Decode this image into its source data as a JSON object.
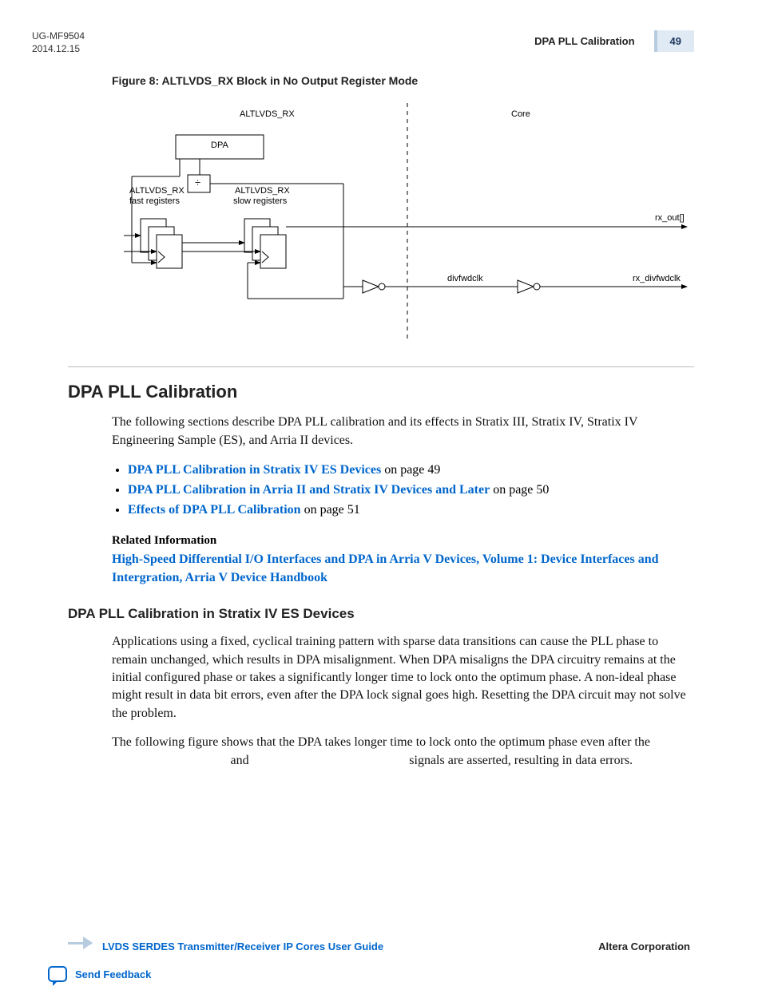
{
  "header": {
    "doc_id": "UG-MF9504",
    "date": "2014.12.15",
    "section_title": "DPA PLL Calibration",
    "page_num": "49"
  },
  "figure": {
    "caption": "Figure 8: ALTLVDS_RX Block in No Output Register Mode",
    "labels": {
      "altlvds_rx_top": "ALTLVDS_RX",
      "core": "Core",
      "dpa": "DPA",
      "divide": "÷",
      "fast_line1": "ALTLVDS_RX",
      "fast_line2": "fast registers",
      "slow_line1": "ALTLVDS_RX",
      "slow_line2": "slow registers",
      "rx_out": "rx_out[]",
      "divfwdclk": "divfwdclk",
      "rx_divfwdclk": "rx_divfwdclk"
    }
  },
  "h2": "DPA PLL Calibration",
  "intro": "The following sections describe DPA PLL calibration and its effects in Stratix III, Stratix IV, Stratix IV Engineering Sample (ES), and Arria II  devices.",
  "bullets": [
    {
      "link": "DPA PLL Calibration in Stratix IV ES Devices",
      "suffix": " on page 49"
    },
    {
      "link": "DPA PLL Calibration in Arria II and Stratix IV Devices and Later",
      "suffix": " on page 50"
    },
    {
      "link": "Effects of DPA PLL Calibration",
      "suffix": " on page 51"
    }
  ],
  "related": {
    "hdr": "Related Information",
    "link": "High-Speed Differential I/O Interfaces and DPA in Arria V Devices, Volume 1: Device Interfaces and Intergration, Arria V Device Handbook"
  },
  "h3": "DPA PLL Calibration in Stratix IV ES Devices",
  "para2": "Applications using a fixed, cyclical training pattern with sparse data transitions can cause the PLL phase to remain unchanged, which results in DPA misalignment. When DPA misaligns the DPA circuitry remains at the initial configured phase or takes a significantly longer time to lock onto the optimum phase. A non-ideal phase might result in data bit errors, even after the DPA lock signal goes high. Resetting the DPA circuit may not solve the problem.",
  "para3_a": "The following figure shows that the DPA takes longer time to lock onto the optimum phase even after the",
  "para3_b": " and ",
  "para3_c": " signals are asserted, resulting in data errors.",
  "footer": {
    "guide": "LVDS SERDES Transmitter/Receiver IP Cores User Guide",
    "corp": "Altera Corporation",
    "feedback": "Send Feedback"
  }
}
